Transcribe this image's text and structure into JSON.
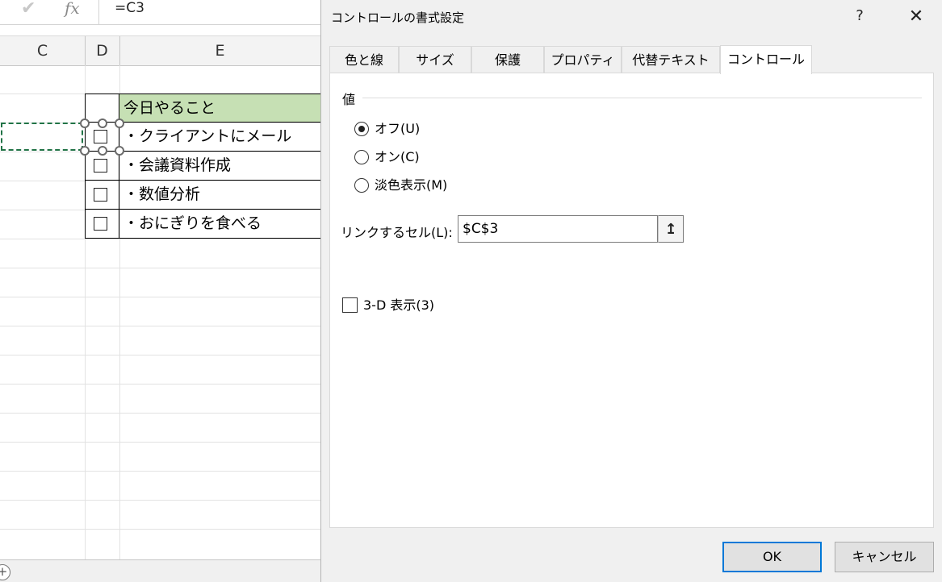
{
  "excel": {
    "formula_bar": {
      "check_icon": "✔",
      "fx_icon": "fx",
      "formula": "=C3"
    },
    "columns": [
      "C",
      "D",
      "E"
    ],
    "todo": {
      "header": "今日やること",
      "items": [
        "・クライアントにメール",
        "・会議資料作成",
        "・数値分析",
        "・おにぎりを食べる"
      ]
    },
    "add_sheet_icon": "+",
    "colors": {
      "header_fill": "#c6e0b4",
      "selection": "#217346"
    }
  },
  "dialog": {
    "title": "コントロールの書式設定",
    "help": "?",
    "close": "✕",
    "tabs": [
      "色と線",
      "サイズ",
      "保護",
      "プロパティ",
      "代替テキスト",
      "コントロール"
    ],
    "active_tab": "コントロール",
    "value_group": {
      "label": "値",
      "options": [
        {
          "label": "オフ(U)",
          "selected": true
        },
        {
          "label": "オン(C)",
          "selected": false
        },
        {
          "label": "淡色表示(M)",
          "selected": false
        }
      ]
    },
    "link_cell": {
      "label": "リンクするセル(L):",
      "value": "$C$3",
      "ref_icon": "↥"
    },
    "shading_3d": {
      "label": "3-D 表示(3)",
      "checked": false
    },
    "ok_label": "OK",
    "cancel_label": "キャンセル",
    "colors": {
      "ok_border": "#0078d7"
    }
  }
}
